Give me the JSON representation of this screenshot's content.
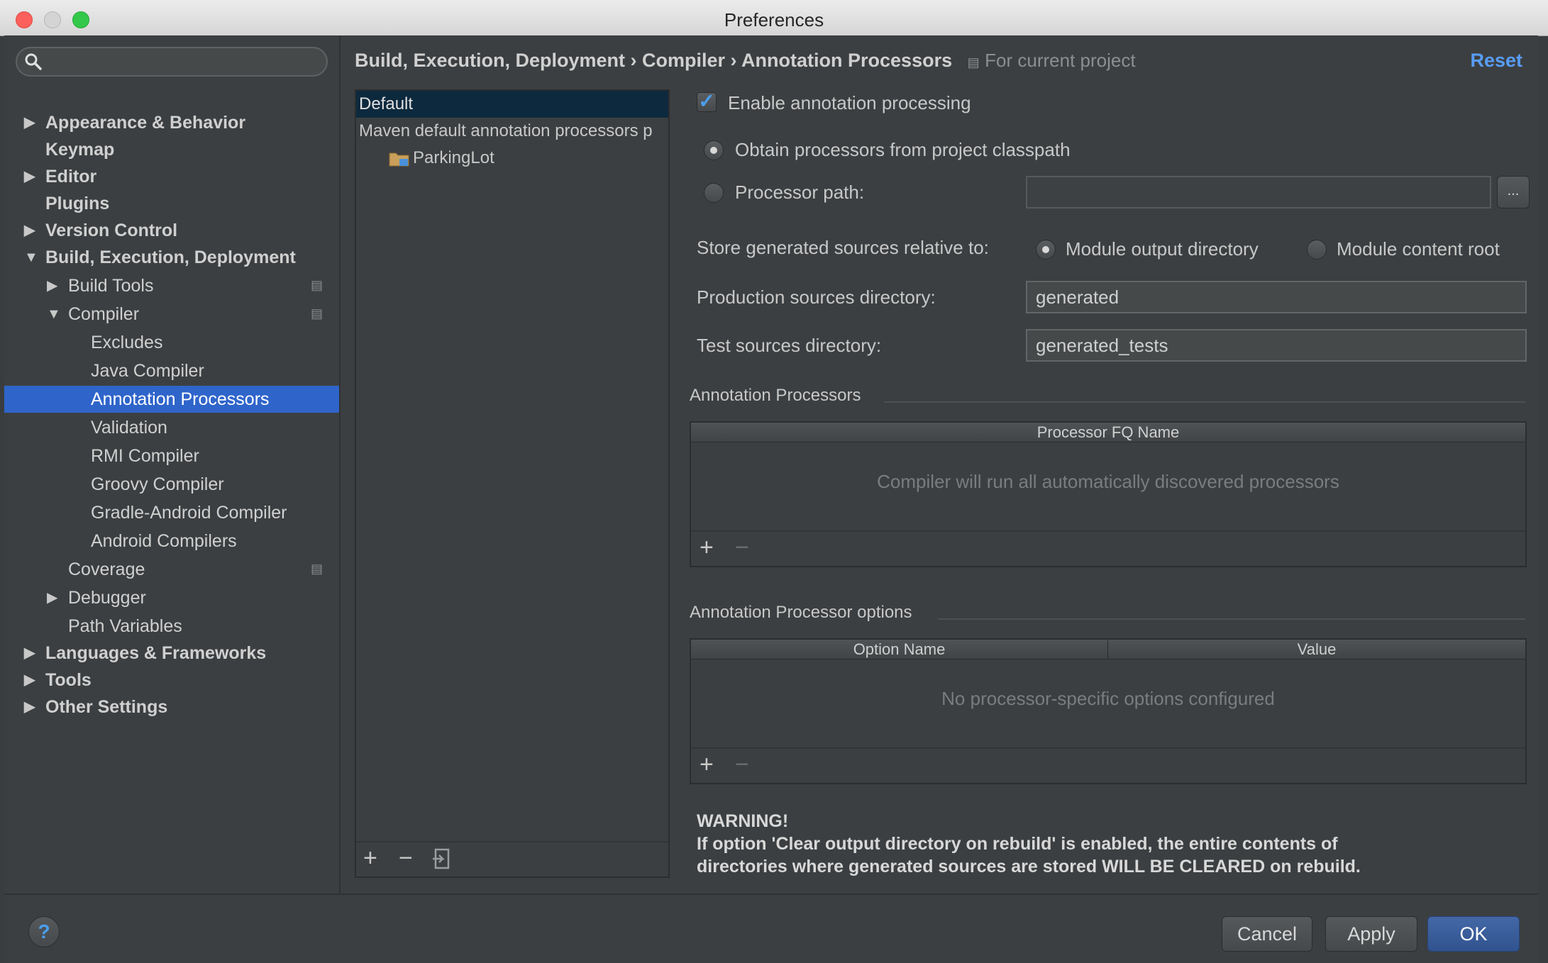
{
  "window": {
    "title": "Preferences"
  },
  "search": {
    "placeholder": ""
  },
  "sidebar": {
    "items": [
      {
        "label": "Appearance & Behavior",
        "level": 0,
        "arrow": "▶",
        "bold": true
      },
      {
        "label": "Keymap",
        "level": 0,
        "arrow": "",
        "bold": true
      },
      {
        "label": "Editor",
        "level": 0,
        "arrow": "▶",
        "bold": true
      },
      {
        "label": "Plugins",
        "level": 0,
        "arrow": "",
        "bold": true
      },
      {
        "label": "Version Control",
        "level": 0,
        "arrow": "▶",
        "bold": true
      },
      {
        "label": "Build, Execution, Deployment",
        "level": 0,
        "arrow": "▼",
        "bold": true
      },
      {
        "label": "Build Tools",
        "level": 1,
        "arrow": "▶",
        "project_icon": true
      },
      {
        "label": "Compiler",
        "level": 1,
        "arrow": "▼",
        "project_icon": true
      },
      {
        "label": "Excludes",
        "level": 2,
        "arrow": ""
      },
      {
        "label": "Java Compiler",
        "level": 2,
        "arrow": ""
      },
      {
        "label": "Annotation Processors",
        "level": 2,
        "arrow": "",
        "selected": true
      },
      {
        "label": "Validation",
        "level": 2,
        "arrow": ""
      },
      {
        "label": "RMI Compiler",
        "level": 2,
        "arrow": ""
      },
      {
        "label": "Groovy Compiler",
        "level": 2,
        "arrow": ""
      },
      {
        "label": "Gradle-Android Compiler",
        "level": 2,
        "arrow": ""
      },
      {
        "label": "Android Compilers",
        "level": 2,
        "arrow": ""
      },
      {
        "label": "Coverage",
        "level": 1,
        "arrow": "",
        "project_icon": true
      },
      {
        "label": "Debugger",
        "level": 1,
        "arrow": "▶"
      },
      {
        "label": "Path Variables",
        "level": 1,
        "arrow": ""
      },
      {
        "label": "Languages & Frameworks",
        "level": 0,
        "arrow": "▶",
        "bold": true
      },
      {
        "label": "Tools",
        "level": 0,
        "arrow": "▶",
        "bold": true
      },
      {
        "label": "Other Settings",
        "level": 0,
        "arrow": "▶",
        "bold": true
      }
    ]
  },
  "breadcrumb": {
    "path": "Build, Execution, Deployment › Compiler › Annotation Processors",
    "scope": "For current project",
    "reset_label": "Reset"
  },
  "profiles": {
    "rows": [
      {
        "label": "Default",
        "selected": true
      },
      {
        "label": "Maven default annotation processors p"
      },
      {
        "label": "ParkingLot"
      }
    ]
  },
  "settings": {
    "enable_label": "Enable annotation processing",
    "enable_checked": true,
    "obtain_label": "Obtain processors from project classpath",
    "processor_path_label": "Processor path:",
    "processor_path_value": "",
    "browse_label": "...",
    "store_label": "Store generated sources relative to:",
    "module_output_label": "Module output directory",
    "module_content_label": "Module content root",
    "production_label": "Production sources directory:",
    "production_value": "generated",
    "test_label": "Test sources directory:",
    "test_value": "generated_tests"
  },
  "processors_table": {
    "section_title": "Annotation Processors",
    "column": "Processor FQ Name",
    "empty": "Compiler will run all automatically discovered processors"
  },
  "options_table": {
    "section_title": "Annotation Processor options",
    "col_name": "Option Name",
    "col_value": "Value",
    "empty": "No processor-specific options configured"
  },
  "warning": {
    "title": "WARNING!",
    "line1": "If option 'Clear output directory on rebuild' is enabled, the entire contents of",
    "line2": "directories where generated sources are stored WILL BE CLEARED on rebuild."
  },
  "footer": {
    "help_label": "?",
    "cancel_label": "Cancel",
    "apply_label": "Apply",
    "ok_label": "OK"
  }
}
